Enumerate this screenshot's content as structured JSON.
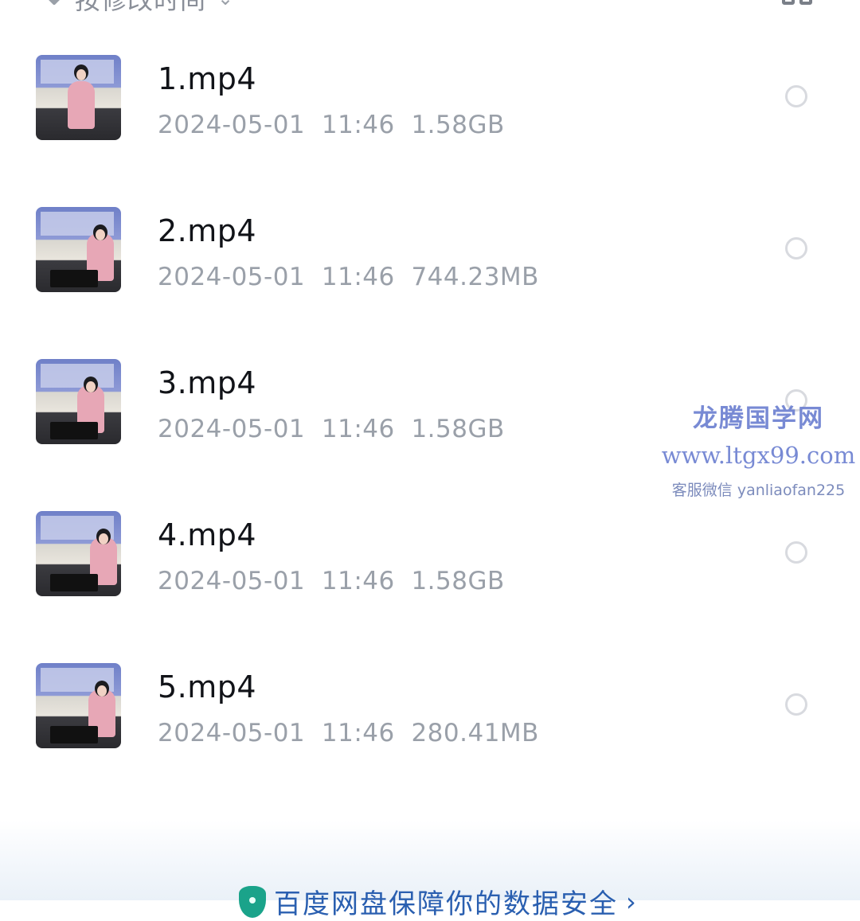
{
  "header": {
    "sort_label": "按修改时间",
    "sort_chevron": "⌄",
    "grid_icon": "grid-view-icon"
  },
  "files": [
    {
      "name": "1.mp4",
      "date": "2024-05-01",
      "time": "11:46",
      "size": "1.58GB"
    },
    {
      "name": "2.mp4",
      "date": "2024-05-01",
      "time": "11:46",
      "size": "744.23MB"
    },
    {
      "name": "3.mp4",
      "date": "2024-05-01",
      "time": "11:46",
      "size": "1.58GB"
    },
    {
      "name": "4.mp4",
      "date": "2024-05-01",
      "time": "11:46",
      "size": "1.58GB"
    },
    {
      "name": "5.mp4",
      "date": "2024-05-01",
      "time": "11:46",
      "size": "280.41MB"
    }
  ],
  "watermark": {
    "title": "龙腾国学网",
    "url": "www.ltgx99.com",
    "contact": "客服微信 yanliaofan225"
  },
  "banner": {
    "text": "百度网盘保障你的数据安全",
    "chevron": "›"
  },
  "colors": {
    "text_primary": "#111318",
    "text_secondary": "#9aa0a9",
    "accent_link": "#2a5fb0",
    "shield": "#1aa38a",
    "watermark": "#6a7ed0"
  }
}
